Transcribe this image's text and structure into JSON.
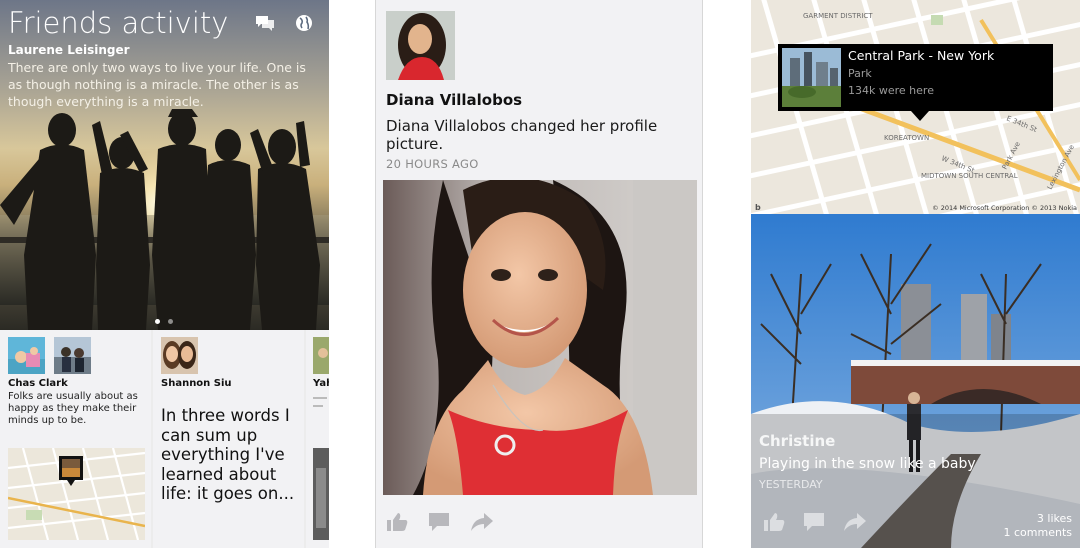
{
  "panel1": {
    "header": {
      "title": "Friends activity",
      "icons": [
        "messages-icon",
        "globe-icon"
      ]
    },
    "featured_post": {
      "author": "Laurene Leisinger",
      "text": "There are only two ways to live your life. One is as though nothing is a miracle. The other is as though everything is a miracle.",
      "carousel": {
        "pages": 2,
        "active": 1
      }
    },
    "tiles": [
      {
        "name": "Chas Clark",
        "text": "Folks are usually about as happy as they make their minds up to be."
      },
      {
        "name": "Shannon Siu",
        "text": "In three words I can sum up everything I've learned about life: it goes on..."
      },
      {
        "name": "Yah"
      }
    ]
  },
  "panel2": {
    "post": {
      "name": "Diana Villalobos",
      "text": "Diana Villalobos changed her profile picture.",
      "time": "20 HOURS AGO"
    },
    "actions": [
      "like-icon",
      "comment-icon",
      "share-icon"
    ]
  },
  "panel3": {
    "map": {
      "place_title": "Central Park - New York",
      "place_type": "Park",
      "checkins": "134k were here",
      "copyright": "© 2014 Microsoft Corporation © 2013 Nokia",
      "labels": [
        "GARMENT DISTRICT",
        "KOREATOWN",
        "MIDTOWN SOUTH CENTRAL",
        "W 34th St",
        "E 34th St",
        "Park Ave",
        "Lexington Ave"
      ]
    },
    "photo_post": {
      "author": "Christine",
      "text": "Playing in the snow like a baby",
      "time": "YESTERDAY",
      "likes": "3 likes",
      "comments": "1 comments"
    }
  },
  "colors": {
    "page_bg": "#ffffff",
    "panel_bg": "#f2f2f4",
    "meta_gray": "#8a8a8a",
    "map_callout": "#000000"
  }
}
